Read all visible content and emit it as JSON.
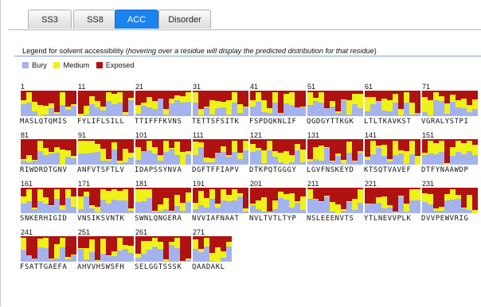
{
  "tabs": [
    {
      "label": "SS3"
    },
    {
      "label": "SS8"
    },
    {
      "label": "ACC"
    },
    {
      "label": "Disorder"
    }
  ],
  "legend": {
    "title": "Legend for solvent accessibility",
    "hint": "hovering over a residue will display the predicted distribution for that residue",
    "items": [
      {
        "label": "Bury",
        "color": "#a4b3ee"
      },
      {
        "label": "Medium",
        "color": "#eef216"
      },
      {
        "label": "Exposed",
        "color": "#b01111"
      }
    ]
  },
  "blocks": [
    {
      "start": "1",
      "sequence": "MASLQTQMIS"
    },
    {
      "start": "11",
      "sequence": "FYLIFLSILL"
    },
    {
      "start": "21",
      "sequence": "TTIFFFKVNS"
    },
    {
      "start": "31",
      "sequence": "TETTSFSITK"
    },
    {
      "start": "41",
      "sequence": "FSPDQKNLIF"
    },
    {
      "start": "51",
      "sequence": "QGDGYTTKGK"
    },
    {
      "start": "61",
      "sequence": "LTLTKAVKST"
    },
    {
      "start": "71",
      "sequence": "VGRALYSTPI"
    },
    {
      "start": "81",
      "sequence": "RIWDRDTGNV"
    },
    {
      "start": "91",
      "sequence": "ANFVTSFTLV"
    },
    {
      "start": "101",
      "sequence": "IDAPSSYNVA"
    },
    {
      "start": "111",
      "sequence": "DGFTFFIAPV"
    },
    {
      "start": "121",
      "sequence": "DTKPQTGGGY"
    },
    {
      "start": "131",
      "sequence": "LGVFNSKEYD"
    },
    {
      "start": "141",
      "sequence": "KTSQTVAVEF"
    },
    {
      "start": "151",
      "sequence": "DTFYNAAWDP"
    },
    {
      "start": "161",
      "sequence": "SNKERHIGID"
    },
    {
      "start": "171",
      "sequence": "VNSIKSVNTK"
    },
    {
      "start": "181",
      "sequence": "SWNLQNGERA"
    },
    {
      "start": "191",
      "sequence": "NVVIAFNAAT"
    },
    {
      "start": "201",
      "sequence": "NVLTVTLTYP"
    },
    {
      "start": "211",
      "sequence": "NSLEEENVTS"
    },
    {
      "start": "221",
      "sequence": "YTLNEVVPLK"
    },
    {
      "start": "231",
      "sequence": "DVVPEWVRIG"
    },
    {
      "start": "241",
      "sequence": "FSATTGAEFA"
    },
    {
      "start": "251",
      "sequence": "AHVVHSWSFH"
    },
    {
      "start": "261",
      "sequence": "SELGGTSSSK"
    },
    {
      "start": "271",
      "sequence": "QAADAKL"
    }
  ]
}
